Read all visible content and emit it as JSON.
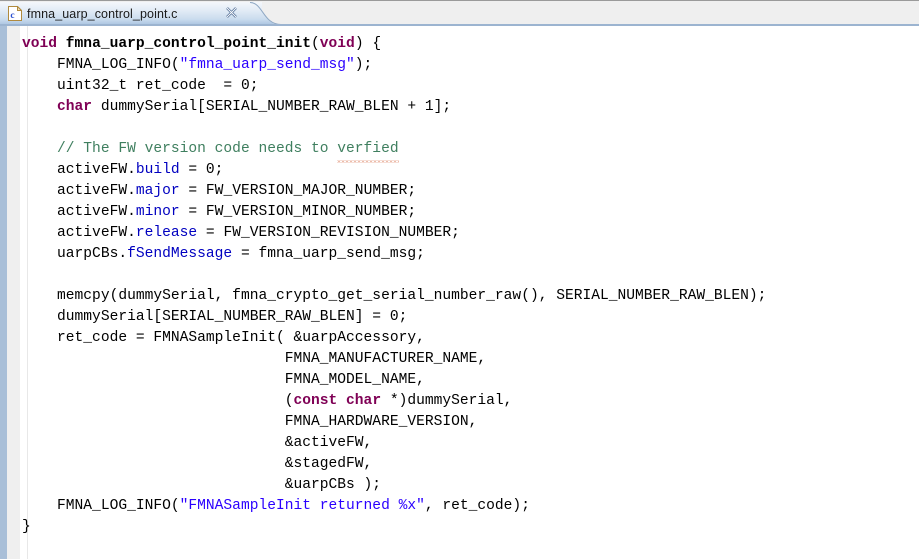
{
  "window": {
    "tab": {
      "icon": "c-source-file-icon",
      "title": "fmna_uarp_control_point.c",
      "close_icon": "close-icon",
      "close_glyph": "✖"
    }
  },
  "colors": {
    "keyword": "#7f0055",
    "string": "#2a00ff",
    "comment": "#3f7f5f",
    "field": "#0000c0",
    "plain": "#000000",
    "editor_background": "#ffffff",
    "gutter_background": "#efefef",
    "edge_strip": "#a9bfd8",
    "tab_underline": "#9cb4d0",
    "spellcheck_squiggle": "#d97b5a"
  },
  "code": {
    "language": "C",
    "lines": [
      {
        "n": 1,
        "tokens": [
          {
            "t": "kw",
            "v": "void"
          },
          {
            "t": "pln",
            "v": " "
          },
          {
            "t": "fn",
            "v": "fmna_uarp_control_point_init"
          },
          {
            "t": "pln",
            "v": "("
          },
          {
            "t": "kw",
            "v": "void"
          },
          {
            "t": "pln",
            "v": ") {"
          }
        ]
      },
      {
        "n": 2,
        "tokens": [
          {
            "t": "pln",
            "v": "    FMNA_LOG_INFO("
          },
          {
            "t": "str",
            "v": "\"fmna_uarp_send_msg\""
          },
          {
            "t": "pln",
            "v": ");"
          }
        ]
      },
      {
        "n": 3,
        "tokens": [
          {
            "t": "pln",
            "v": "    uint32_t ret_code  = 0;"
          }
        ]
      },
      {
        "n": 4,
        "tokens": [
          {
            "t": "pln",
            "v": "    "
          },
          {
            "t": "kw",
            "v": "char"
          },
          {
            "t": "pln",
            "v": " dummySerial[SERIAL_NUMBER_RAW_BLEN + 1];"
          }
        ]
      },
      {
        "n": 5,
        "tokens": []
      },
      {
        "n": 6,
        "tokens": [
          {
            "t": "cmt",
            "v": "    // The FW version code needs to "
          },
          {
            "t": "cmt-sq",
            "v": "verfied"
          }
        ]
      },
      {
        "n": 7,
        "tokens": [
          {
            "t": "pln",
            "v": "    activeFW."
          },
          {
            "t": "fld",
            "v": "build"
          },
          {
            "t": "pln",
            "v": " = 0;"
          }
        ]
      },
      {
        "n": 8,
        "tokens": [
          {
            "t": "pln",
            "v": "    activeFW."
          },
          {
            "t": "fld",
            "v": "major"
          },
          {
            "t": "pln",
            "v": " = FW_VERSION_MAJOR_NUMBER;"
          }
        ]
      },
      {
        "n": 9,
        "tokens": [
          {
            "t": "pln",
            "v": "    activeFW."
          },
          {
            "t": "fld",
            "v": "minor"
          },
          {
            "t": "pln",
            "v": " = FW_VERSION_MINOR_NUMBER;"
          }
        ]
      },
      {
        "n": 10,
        "tokens": [
          {
            "t": "pln",
            "v": "    activeFW."
          },
          {
            "t": "fld",
            "v": "release"
          },
          {
            "t": "pln",
            "v": " = FW_VERSION_REVISION_NUMBER;"
          }
        ]
      },
      {
        "n": 11,
        "tokens": [
          {
            "t": "pln",
            "v": "    uarpCBs."
          },
          {
            "t": "fld",
            "v": "fSendMessage"
          },
          {
            "t": "pln",
            "v": " = fmna_uarp_send_msg;"
          }
        ]
      },
      {
        "n": 12,
        "tokens": []
      },
      {
        "n": 13,
        "tokens": [
          {
            "t": "pln",
            "v": "    memcpy(dummySerial, fmna_crypto_get_serial_number_raw(), SERIAL_NUMBER_RAW_BLEN);"
          }
        ]
      },
      {
        "n": 14,
        "tokens": [
          {
            "t": "pln",
            "v": "    dummySerial[SERIAL_NUMBER_RAW_BLEN] = 0;"
          }
        ]
      },
      {
        "n": 15,
        "tokens": [
          {
            "t": "pln",
            "v": "    ret_code = FMNASampleInit( &uarpAccessory,"
          }
        ]
      },
      {
        "n": 16,
        "tokens": [
          {
            "t": "pln",
            "v": "                              FMNA_MANUFACTURER_NAME,"
          }
        ]
      },
      {
        "n": 17,
        "tokens": [
          {
            "t": "pln",
            "v": "                              FMNA_MODEL_NAME,"
          }
        ]
      },
      {
        "n": 18,
        "tokens": [
          {
            "t": "pln",
            "v": "                              ("
          },
          {
            "t": "kw",
            "v": "const char"
          },
          {
            "t": "pln",
            "v": " *)dummySerial,"
          }
        ]
      },
      {
        "n": 19,
        "tokens": [
          {
            "t": "pln",
            "v": "                              FMNA_HARDWARE_VERSION,"
          }
        ]
      },
      {
        "n": 20,
        "tokens": [
          {
            "t": "pln",
            "v": "                              &activeFW,"
          }
        ]
      },
      {
        "n": 21,
        "tokens": [
          {
            "t": "pln",
            "v": "                              &stagedFW,"
          }
        ]
      },
      {
        "n": 22,
        "tokens": [
          {
            "t": "pln",
            "v": "                              &uarpCBs );"
          }
        ]
      },
      {
        "n": 23,
        "tokens": [
          {
            "t": "pln",
            "v": "    FMNA_LOG_INFO("
          },
          {
            "t": "str",
            "v": "\"FMNASampleInit returned %x\""
          },
          {
            "t": "pln",
            "v": ", ret_code);"
          }
        ]
      },
      {
        "n": 24,
        "tokens": [
          {
            "t": "pln",
            "v": "}"
          }
        ]
      }
    ]
  }
}
